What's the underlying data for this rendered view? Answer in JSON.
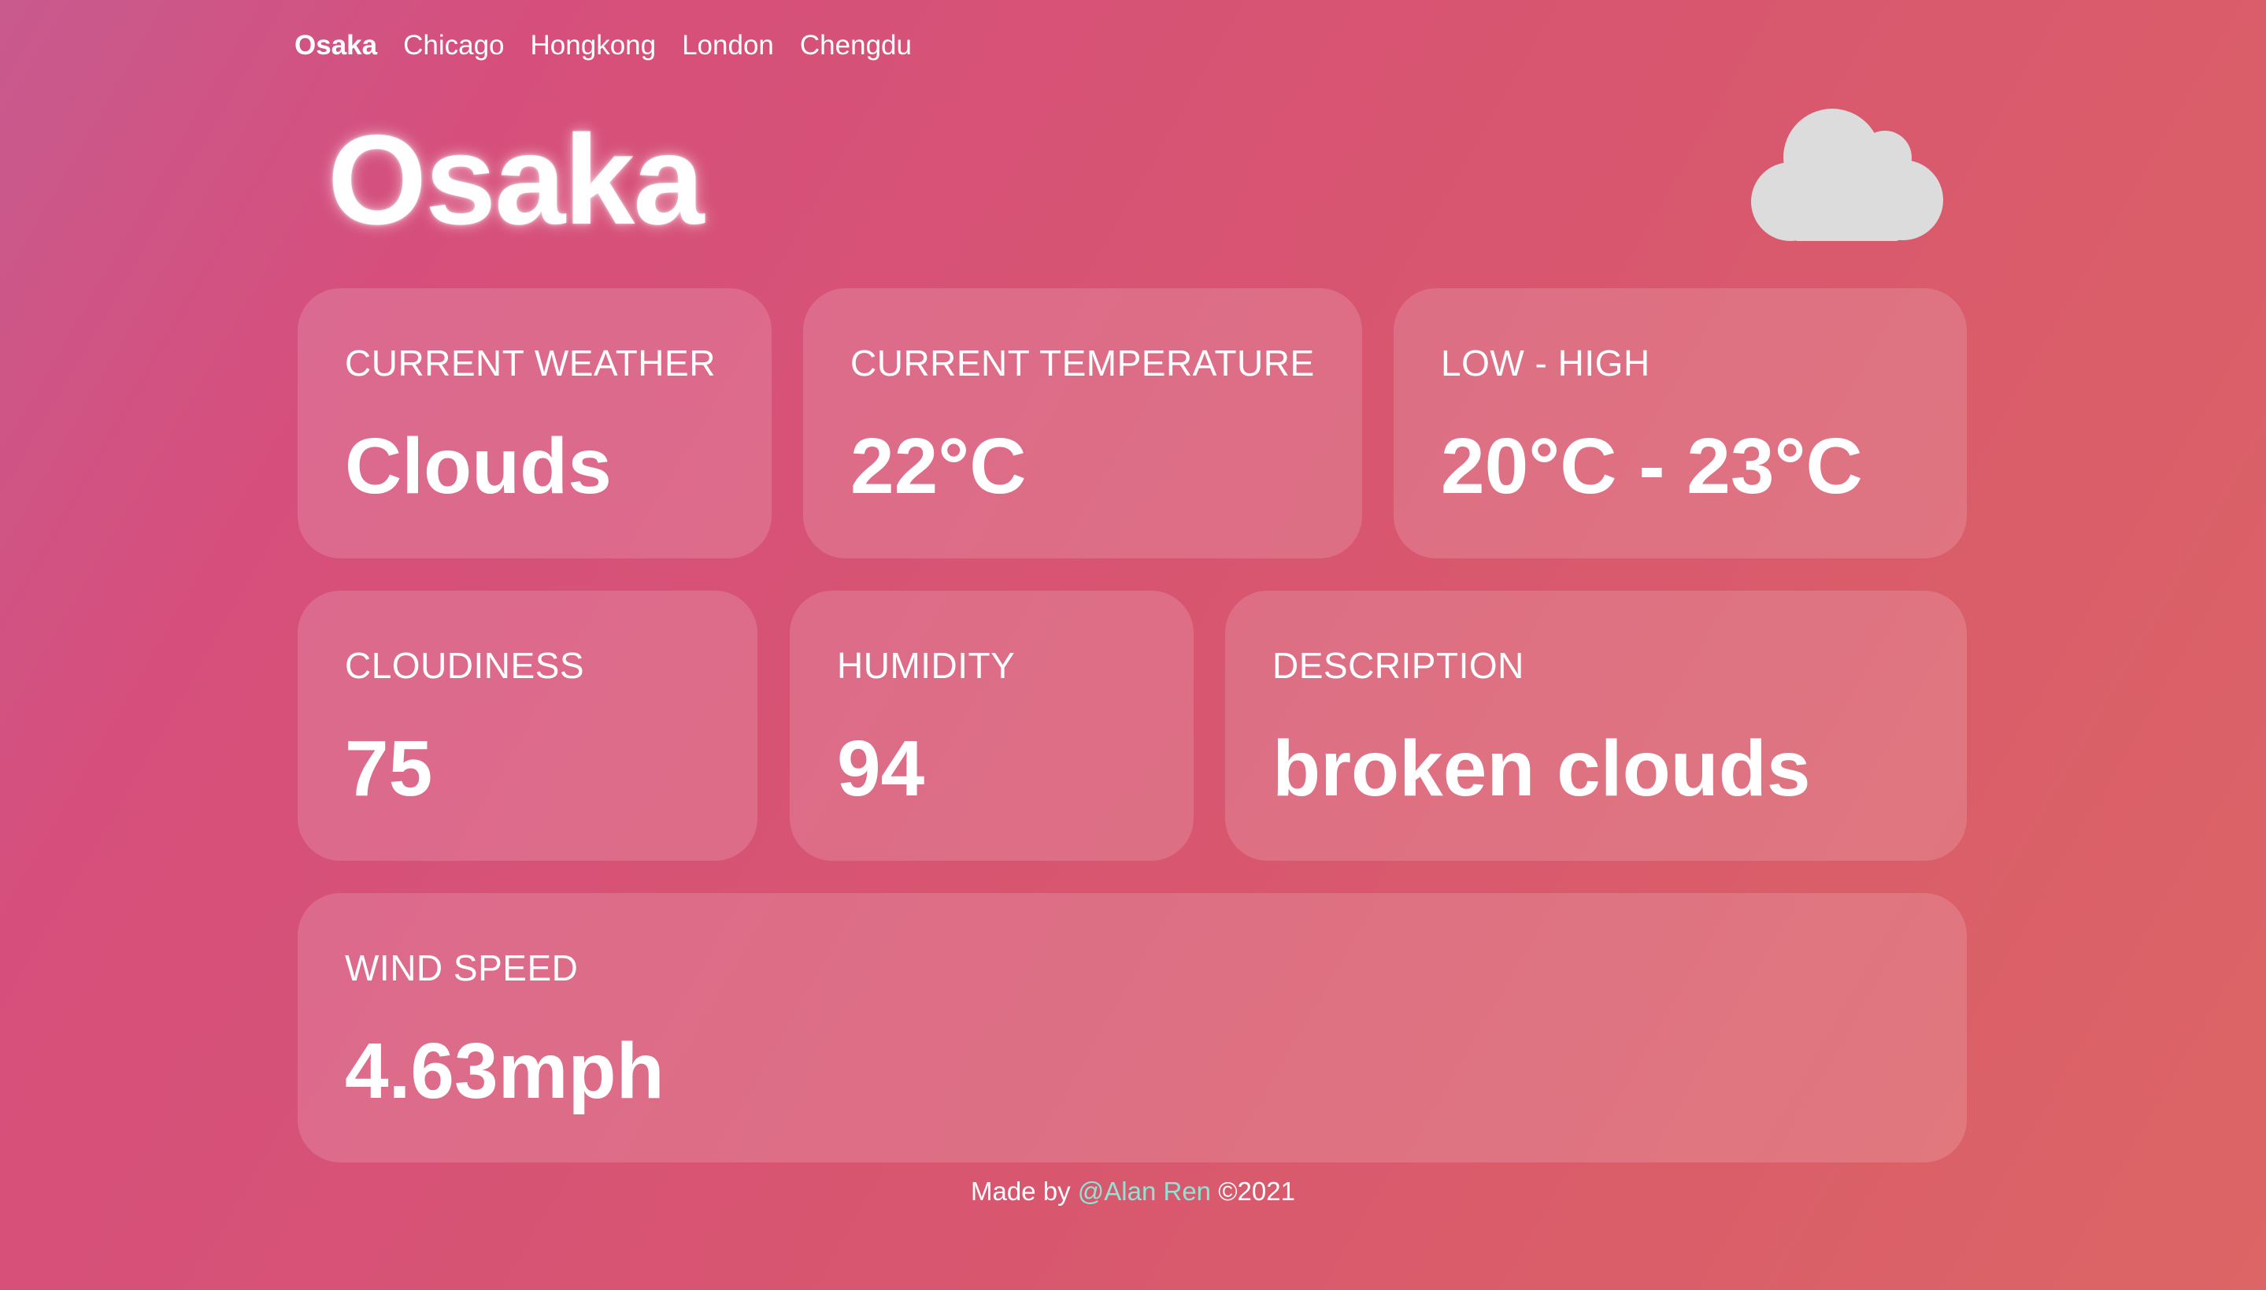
{
  "nav": {
    "cities": [
      "Osaka",
      "Chicago",
      "Hongkong",
      "London",
      "Chengdu"
    ],
    "active": "Osaka"
  },
  "city": {
    "name": "Osaka",
    "icon": "cloud-icon"
  },
  "cards": {
    "current_weather": {
      "label": "CURRENT WEATHER",
      "value": "Clouds"
    },
    "current_temperature": {
      "label": "CURRENT TEMPERATURE",
      "value": "22°C"
    },
    "low_high": {
      "label": "LOW - HIGH",
      "value": "20°C - 23°C"
    },
    "cloudiness": {
      "label": "CLOUDINESS",
      "value": "75"
    },
    "humidity": {
      "label": "HUMIDITY",
      "value": "94"
    },
    "description": {
      "label": "DESCRIPTION",
      "value": "broken clouds"
    },
    "wind_speed": {
      "label": "WIND SPEED",
      "value": "4.63mph"
    }
  },
  "footer": {
    "prefix": "Made by ",
    "author": "@Alan Ren",
    "suffix": " ©2021"
  },
  "colors": {
    "background_start": "#c85a8e",
    "background_end": "#dc6565",
    "link_accent": "#8fe3d3",
    "cloud_icon": "#dcdcdc"
  }
}
